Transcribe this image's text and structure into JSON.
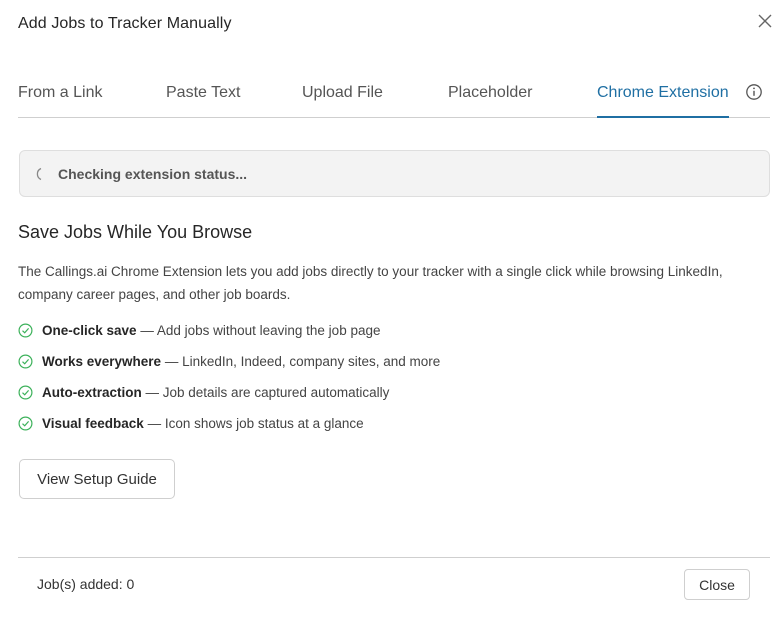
{
  "dialog": {
    "title": "Add Jobs to Tracker Manually",
    "close_icon": "close-icon"
  },
  "tabs": [
    {
      "label": "From a Link",
      "active": false
    },
    {
      "label": "Paste Text",
      "active": false
    },
    {
      "label": "Upload File",
      "active": false
    },
    {
      "label": "Placeholder",
      "active": false
    },
    {
      "label": "Chrome Extension",
      "active": true
    }
  ],
  "info_icon": "info-icon",
  "status": {
    "text": "Checking extension status...",
    "icon": "spinner-icon"
  },
  "section": {
    "title": "Save Jobs While You Browse",
    "description": "The Callings.ai Chrome Extension lets you add jobs directly to your tracker with a single click while browsing LinkedIn, company career pages, and other job boards."
  },
  "features": [
    {
      "bold": "One-click save",
      "rest": " — Add jobs without leaving the job page"
    },
    {
      "bold": "Works everywhere",
      "rest": " — LinkedIn, Indeed, company sites, and more"
    },
    {
      "bold": "Auto-extraction",
      "rest": " — Job details are captured automatically"
    },
    {
      "bold": "Visual feedback",
      "rest": " — Icon shows job status at a glance"
    }
  ],
  "guide_button": "View Setup Guide",
  "footer": {
    "jobs_added": "Job(s) added: 0",
    "close_label": "Close"
  },
  "colors": {
    "accent": "#1f6fa3",
    "check": "#3cb15a",
    "status_bg": "#f3f3f3"
  }
}
